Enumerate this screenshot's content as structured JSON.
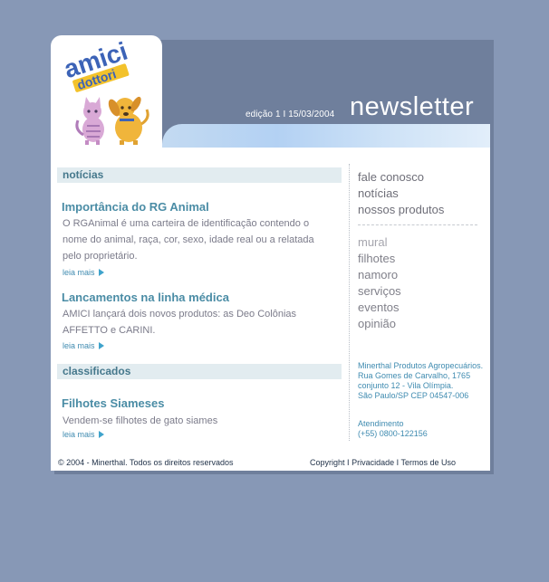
{
  "brand": {
    "logo_top": "amici",
    "logo_bottom": "dottori"
  },
  "header": {
    "edition": "edição 1 I 15/03/2004",
    "title": "newsletter"
  },
  "sections": {
    "news_label": "notícias",
    "classified_label": "classificados"
  },
  "articles": [
    {
      "title": "Importância do RG Animal",
      "body": "O RGAnimal é uma carteira de identificação contendo o nome do animal, raça, cor, sexo, idade real ou a relatada pelo proprietário.",
      "more": "leia mais"
    },
    {
      "title": "Lancamentos na linha médica",
      "body": "AMICI lançará dois novos produtos: as Deo Colônias AFFETTO e CARINI.",
      "more": "leia mais"
    },
    {
      "title": "Filhotes Siameses",
      "body": "Vendem-se filhotes de gato siames",
      "more": "leia mais"
    }
  ],
  "sidebar": {
    "top_links": [
      "fale conosco",
      "notícias",
      "nossos produtos"
    ],
    "section_header": "mural",
    "nav": [
      "filhotes",
      "namoro",
      "serviços",
      "eventos",
      "opinião"
    ],
    "company": "Minerthal Produtos Agropecuários.",
    "address_line1": "Rua Gomes de Carvalho, 1765",
    "address_line2": "conjunto 12 - Vila Olímpia.",
    "address_line3": "São Paulo/SP CEP 04547-006",
    "support_label": "Atendimento",
    "support_phone": "(+55) 0800-122156"
  },
  "footer": {
    "copyright": "© 2004 - Minerthal. Todos os direitos reservados",
    "copyright_link": "Copyright",
    "privacy_link": "Privacidade",
    "terms_link": "Termos de Uso",
    "separator": "I"
  },
  "colors": {
    "page_bg": "#8798b6",
    "accent": "#4a8ca5",
    "link": "#3f8bb0"
  }
}
